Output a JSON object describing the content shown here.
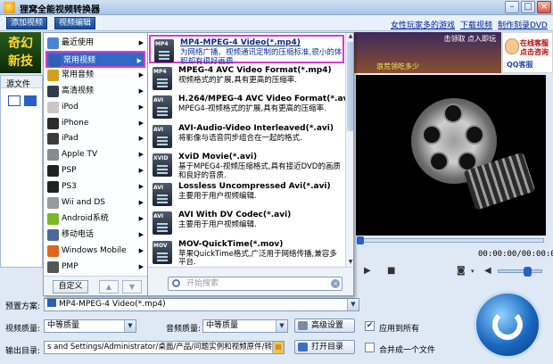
{
  "window": {
    "title": "狸窝全能视频转换器"
  },
  "toolbar": {
    "add_video": "添加视频",
    "edit_video": "视频编辑",
    "links": [
      "女性玩家多的游戏",
      "下载视频",
      "制作刻录DVD"
    ]
  },
  "banner": {
    "line1": "奇幻",
    "line2": "新技"
  },
  "ad": {
    "text1": "击领取",
    "text2": "点入即玩",
    "text3": "迅速攀升",
    "text4": "浪荒领吃多少"
  },
  "service": {
    "line1": "在线客服",
    "line2": "点击咨询",
    "qq": "QQ客服"
  },
  "file_panel": {
    "header": "源文件"
  },
  "menu": {
    "categories": [
      {
        "label": "最近使用",
        "icon": "clock-icon",
        "color": "#4a86d6"
      },
      {
        "label": "常用视频",
        "icon": "film-icon",
        "color": "#2e5fb8"
      },
      {
        "label": "常用音频",
        "icon": "music-icon",
        "color": "#d0a21c"
      },
      {
        "label": "高清视频",
        "icon": "hd-icon",
        "color": "#333c4d"
      },
      {
        "label": "iPod",
        "icon": "ipod-icon",
        "color": "#c7c7c7"
      },
      {
        "label": "iPhone",
        "icon": "iphone-icon",
        "color": "#2b2b2b"
      },
      {
        "label": "iPad",
        "icon": "ipad-icon",
        "color": "#3b3b3b"
      },
      {
        "label": "Apple TV",
        "icon": "appletv-icon",
        "color": "#8a8a8a"
      },
      {
        "label": "PSP",
        "icon": "psp-icon",
        "color": "#222"
      },
      {
        "label": "PS3",
        "icon": "ps3-icon",
        "color": "#222"
      },
      {
        "label": "Wii and DS",
        "icon": "wii-icon",
        "color": "#9a9a9a"
      },
      {
        "label": "Android系统",
        "icon": "android-icon",
        "color": "#7cb824"
      },
      {
        "label": "移动电话",
        "icon": "mobile-icon",
        "color": "#4a6a9a"
      },
      {
        "label": "Windows Mobile",
        "icon": "windows-icon",
        "color": "#e2631d"
      },
      {
        "label": "PMP",
        "icon": "pmp-icon",
        "color": "#555"
      }
    ],
    "selected_index": 1,
    "custom_label": "自定义",
    "search_placeholder": "开始搜索",
    "formats": [
      {
        "name": "MP4-MPEG-4 Video(*.mp4)",
        "desc": "为网络广播、视频通讯定制的压缩标准,很小的体积却有很好画质.",
        "badge": "MP4"
      },
      {
        "name": "MPEG-4 AVC Video Format(*.mp4)",
        "desc": "视频格式的扩展,具有更高的压缩率.",
        "badge": "MP4"
      },
      {
        "name": "H.264/MPEG-4 AVC Video Format(*.avi)",
        "desc": "MPEG4-视频格式的扩展,具有更高的压缩率.",
        "badge": "AVI"
      },
      {
        "name": "AVI-Audio-Video Interleaved(*.avi)",
        "desc": "将影像与语音同步组合在一起的格式.",
        "badge": "AVI"
      },
      {
        "name": "XviD Movie(*.avi)",
        "desc": "基于MPEG4-视频压缩格式,具有接近DVD的画质和良好的音质.",
        "badge": "XVID"
      },
      {
        "name": "Lossless Uncompressed Avi(*.avi)",
        "desc": "主要用于用户视频编辑.",
        "badge": "AVI"
      },
      {
        "name": "AVI With DV Codec(*.avi)",
        "desc": "主要用于用户视频编辑.",
        "badge": "AVI"
      },
      {
        "name": "MOV-QuickTime(*.mov)",
        "desc": "苹果QuickTime格式,广泛用于网络传播,兼容多平台.",
        "badge": "MOV"
      }
    ]
  },
  "player": {
    "time": "00:00:00/00:00:00"
  },
  "bottom": {
    "preset_label": "预置方案:",
    "preset_value": "MP4-MPEG-4 Video(*.mp4)",
    "video_quality_label": "视频质量:",
    "video_quality_value": "中等质量",
    "audio_quality_label": "音频质量:",
    "audio_quality_value": "中等质量",
    "advanced_label": "高级设置",
    "apply_all_label": "应用到所有",
    "output_label": "输出目录:",
    "output_value": "s and Settings/Administrator/桌面/产品/问题实例和视频原件/转换",
    "open_dir_label": "打开目录",
    "merge_label": "合并成一个文件"
  }
}
